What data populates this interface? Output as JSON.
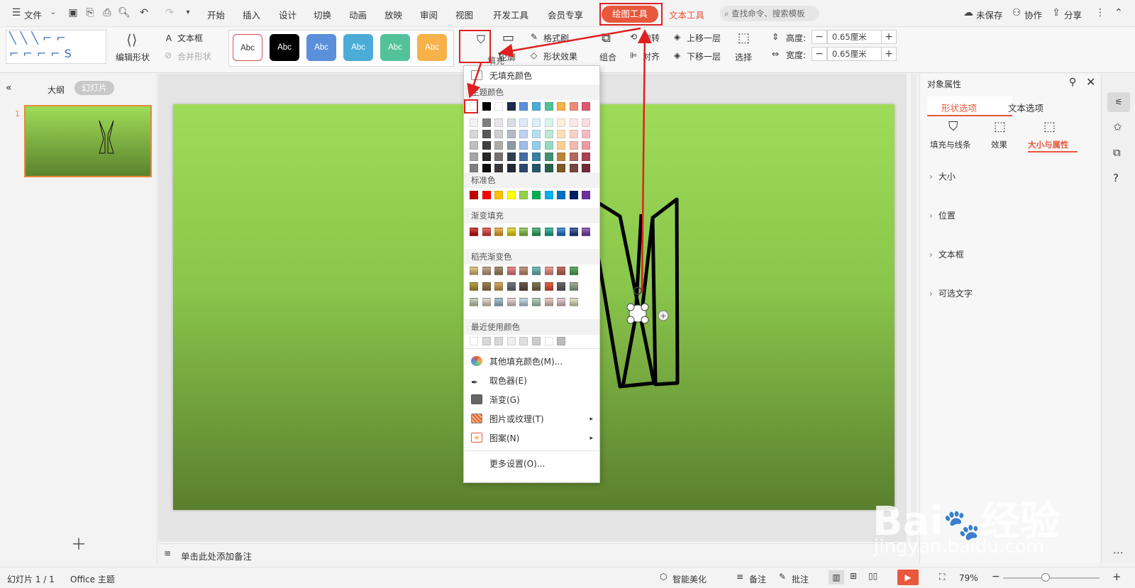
{
  "menubar": {
    "file": "文件",
    "tabs": [
      "开始",
      "插入",
      "设计",
      "切换",
      "动画",
      "放映",
      "审阅",
      "视图",
      "开发工具",
      "会员专享"
    ],
    "draw_tools": "绘图工具",
    "text_tools": "文本工具",
    "search_placeholder": "查找命令、搜索模板",
    "unsaved": "未保存",
    "collab": "协作",
    "share": "分享"
  },
  "ribbon": {
    "edit_shape": "编辑形状",
    "textbox": "文本框",
    "merge_shape": "合并形状",
    "style_label": "Abc",
    "fill": "填充",
    "outline": "轮廓",
    "format_painter": "格式刷",
    "shape_effect": "形状效果",
    "group": "组合",
    "rotate": "旋转",
    "align": "对齐",
    "bring_forward": "上移一层",
    "send_backward": "下移一层",
    "select": "选择",
    "height_label": "高度:",
    "height_value": "0.65厘米",
    "width_label": "宽度:",
    "width_value": "0.65厘米"
  },
  "leftpanel": {
    "outline_tab": "大纲",
    "slides_tab": "幻灯片",
    "slide_number": "1"
  },
  "notes": {
    "placeholder": "单击此处添加备注"
  },
  "dropdown": {
    "no_fill": "无填充颜色",
    "theme_colors": "主题颜色",
    "standard_colors": "标准色",
    "gradient_fill": "渐变填充",
    "shell_gradients": "稻壳渐变色",
    "recent_colors": "最近使用颜色",
    "more_colors": "其他填充颜色(M)...",
    "eyedropper": "取色器(E)",
    "gradient": "渐变(G)",
    "picture_texture": "图片或纹理(T)",
    "pattern": "图案(N)",
    "more_settings": "更多设置(O)...",
    "theme_top_row": [
      "#ffffff",
      "#000000",
      "#ffffff",
      "#1e2a4a",
      "#5b8fd9",
      "#4bacd8",
      "#52c29a",
      "#f7b24a",
      "#ef8a7a",
      "#e25670"
    ],
    "standard_row": [
      "#c00000",
      "#ff0000",
      "#ffc000",
      "#ffff00",
      "#92d050",
      "#00b050",
      "#00b0f0",
      "#0070c0",
      "#002060",
      "#7030a0"
    ],
    "gradient_row": [
      "#c00000",
      "#e03030",
      "#e8a020",
      "#e0d000",
      "#80c040",
      "#20a050",
      "#10a080",
      "#1070c0",
      "#103080",
      "#7030a0"
    ]
  },
  "rightpanel": {
    "title": "对象属性",
    "tab_shape": "形状选项",
    "tab_text": "文本选项",
    "sub_fill": "填充与线条",
    "sub_effect": "效果",
    "sub_size": "大小与属性",
    "sections": [
      "大小",
      "位置",
      "文本框",
      "可选文字"
    ]
  },
  "statusbar": {
    "slide_info": "幻灯片 1 / 1",
    "theme": "Office 主题",
    "beautify": "智能美化",
    "notes": "备注",
    "comments": "批注",
    "zoom": "79%"
  },
  "watermark": {
    "brand": "Bai",
    "brand2": "经验",
    "url": "jingyan.baidu.com"
  }
}
